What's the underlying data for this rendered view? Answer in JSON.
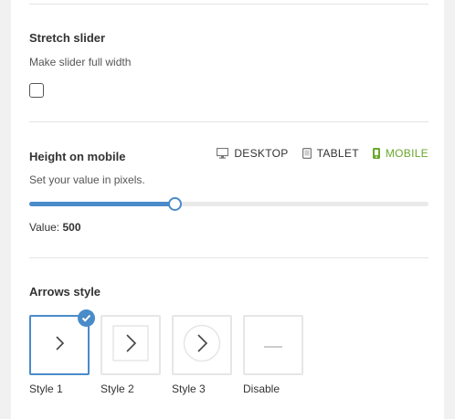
{
  "stretch": {
    "title": "Stretch slider",
    "description": "Make slider full width",
    "checked": false
  },
  "height": {
    "title": "Height on mobile",
    "description": "Set your value in pixels.",
    "devices": [
      {
        "label": "DESKTOP",
        "icon": "desktop-icon",
        "active": false
      },
      {
        "label": "TABLET",
        "icon": "tablet-icon",
        "active": false
      },
      {
        "label": "MOBILE",
        "icon": "mobile-icon",
        "active": true
      }
    ],
    "value_label": "Value:",
    "value": "500",
    "slider_fraction": 0.363
  },
  "arrows": {
    "title": "Arrows style",
    "options": [
      {
        "label": "Style 1",
        "selected": true
      },
      {
        "label": "Style 2",
        "selected": false
      },
      {
        "label": "Style 3",
        "selected": false
      },
      {
        "label": "Disable",
        "selected": false
      }
    ]
  },
  "colors": {
    "accent": "#4a8bc9",
    "active_device": "#6aa82c",
    "divider": "#e5e5e5"
  }
}
